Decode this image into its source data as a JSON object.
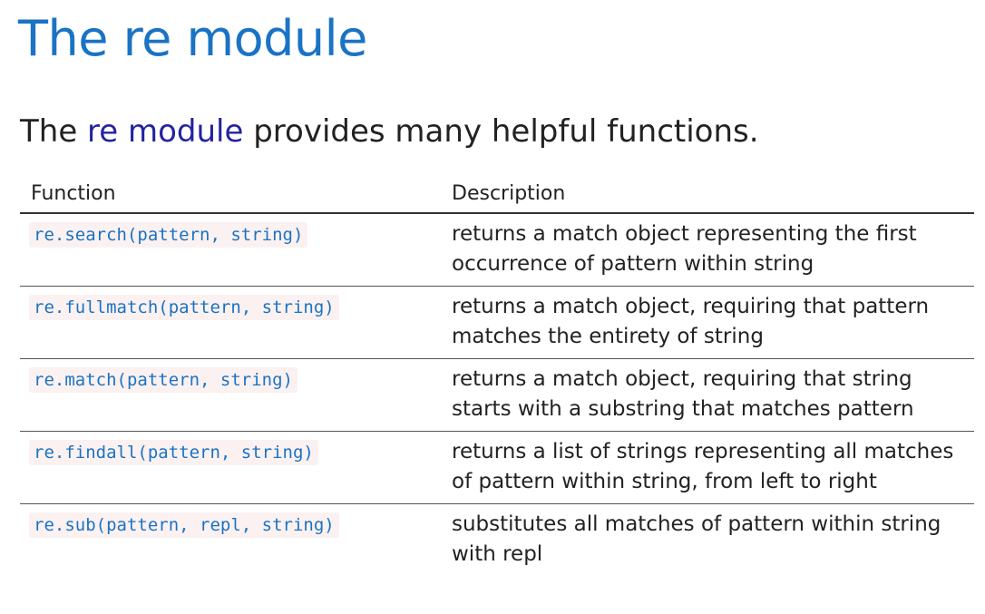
{
  "slide": {
    "title": "The re module",
    "intro": {
      "prefix": "The ",
      "link": "re module",
      "suffix": " provides many helpful functions."
    }
  },
  "table": {
    "headers": [
      "Function",
      "Description"
    ],
    "rows": [
      {
        "function": "re.search(pattern, string)",
        "description": "returns a match object representing the first occurrence of pattern within string"
      },
      {
        "function": "re.fullmatch(pattern, string)",
        "description": "returns a match object, requiring that pattern matches the entirety of string"
      },
      {
        "function": "re.match(pattern, string)",
        "description": "returns a match object, requiring that string starts with a substring that matches pattern"
      },
      {
        "function": "re.findall(pattern, string)",
        "description": "returns a list of strings representing all matches of pattern within string, from left to right"
      },
      {
        "function": "re.sub(pattern, repl, string)",
        "description": "substitutes all matches of pattern within string with repl"
      }
    ]
  },
  "colors": {
    "title": "#1a73c4",
    "link": "#2323a0",
    "code_text": "#1a73c4",
    "code_bg": "#fbf1f1"
  }
}
